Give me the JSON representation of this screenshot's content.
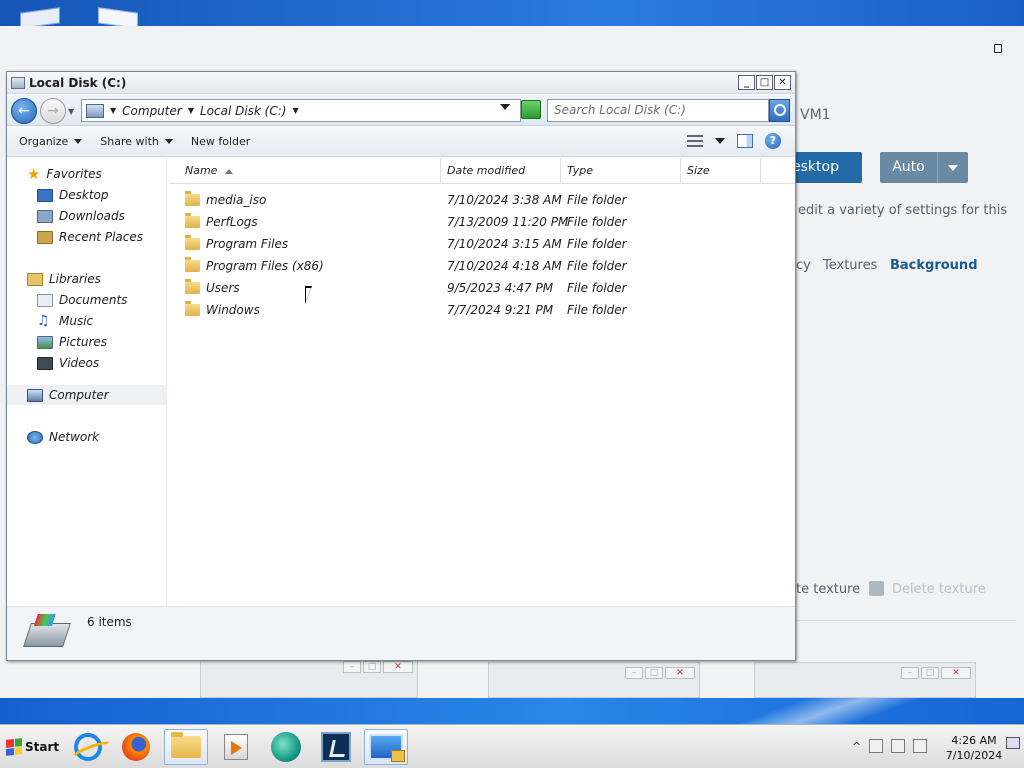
{
  "explorer": {
    "title": "Local Disk (C:)",
    "window_buttons": [
      "_",
      "□",
      "✕"
    ],
    "breadcrumb": [
      "Computer",
      "Local Disk (C:)"
    ],
    "search_placeholder": "Search Local Disk (C:)",
    "toolbar": {
      "organize": "Organize",
      "share_with": "Share with",
      "new_folder": "New folder"
    },
    "nav": {
      "favorites": "Favorites",
      "desktop": "Desktop",
      "downloads": "Downloads",
      "recent_places": "Recent Places",
      "libraries": "Libraries",
      "documents": "Documents",
      "music": "Music",
      "pictures": "Pictures",
      "videos": "Videos",
      "computer": "Computer",
      "network": "Network"
    },
    "columns": {
      "name": "Name",
      "date_modified": "Date modified",
      "type": "Type",
      "size": "Size"
    },
    "files": [
      {
        "name": "media_iso",
        "date": "7/10/2024 3:38 AM",
        "type": "File folder"
      },
      {
        "name": "PerfLogs",
        "date": "7/13/2009 11:20 PM",
        "type": "File folder"
      },
      {
        "name": "Program Files",
        "date": "7/10/2024 3:15 AM",
        "type": "File folder"
      },
      {
        "name": "Program Files (x86)",
        "date": "7/10/2024 4:18 AM",
        "type": "File folder"
      },
      {
        "name": "Users",
        "date": "9/5/2023 4:47 PM",
        "type": "File folder"
      },
      {
        "name": "Windows",
        "date": "7/7/2024 9:21 PM",
        "type": "File folder"
      }
    ],
    "item_count": "6 items"
  },
  "background_app": {
    "vm_name": "VM1",
    "desktop_button": "esktop",
    "auto_button": "Auto",
    "settings_text": "edit a variety of settings for this",
    "tabs": [
      "cy",
      "Textures",
      "Background"
    ],
    "texture_label": "te texture",
    "delete_texture": "Delete texture"
  },
  "taskbar": {
    "start": "Start",
    "time": "4:26 AM",
    "date": "7/10/2024",
    "tray_expand": "^"
  },
  "colors": {
    "accent": "#236aa6",
    "selected_tab": "#1a5a8f",
    "taskbar": "#e6e6e6"
  }
}
